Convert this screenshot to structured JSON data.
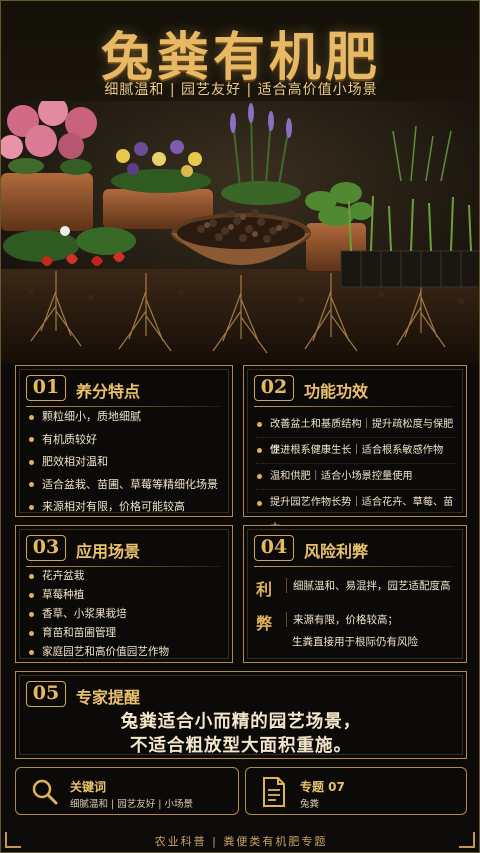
{
  "hero": {
    "title": "兔粪有机肥",
    "subtitle": "细腻温和 | 园艺友好 | 适合高价值小场景"
  },
  "sections": {
    "nutrients": {
      "number": "01",
      "title": "养分特点",
      "items": [
        "颗粒细小，质地细腻",
        "有机质较好",
        "肥效相对温和",
        "适合盆栽、苗圃、草莓等精细化场景",
        "来源相对有限，价格可能较高"
      ]
    },
    "functions": {
      "number": "02",
      "title": "功能功效",
      "items": [
        "改善盆土和基质结构｜提升疏松度与保肥性",
        "促进根系健康生长｜适合根系敏感作物",
        "温和供肥｜适合小场景控量使用",
        "提升园艺作物长势｜适合花卉、草莓、苗木"
      ]
    },
    "scenarios": {
      "number": "03",
      "title": "应用场景",
      "items": [
        "花卉盆栽",
        "草莓种植",
        "香草、小浆果栽培",
        "育苗和苗圃管理",
        "家庭园艺和高价值园艺作物"
      ]
    },
    "risks": {
      "number": "04",
      "title": "风险利弊",
      "pro_key": "利",
      "pro_text": "细腻温和、易混拌，园艺适配度高",
      "con_key": "弊",
      "con_text_1": "来源有限，价格较高；",
      "con_text_2": "生粪直接用于根际仍有风险"
    },
    "expert": {
      "number": "05",
      "title": "专家提醒",
      "line1": "兔粪适合小而精的园艺场景，",
      "line2": "不适合粗放型大面积重施。"
    }
  },
  "footer_cards": {
    "keywords": {
      "icon": "search-icon",
      "title": "关键词",
      "text": "细腻温和 | 园艺友好 | 小场景"
    },
    "topic": {
      "icon": "document-icon",
      "title": "专题 07",
      "text": "兔粪"
    }
  },
  "footer": "农业科普 | 粪便类有机肥专题",
  "colors": {
    "gold": "#e8b964",
    "background": "#0d0b09",
    "border": "#b08a4a"
  }
}
